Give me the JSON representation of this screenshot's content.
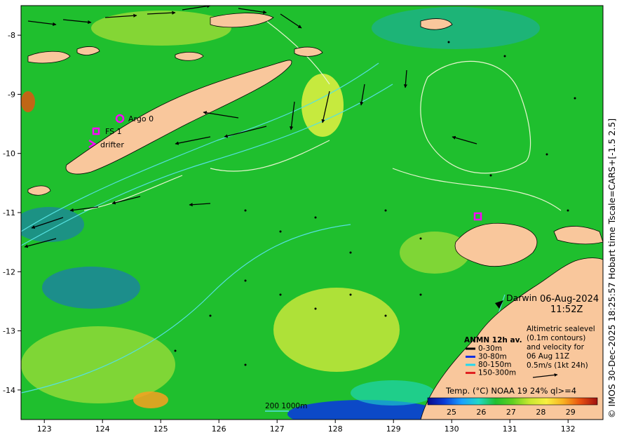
{
  "map": {
    "date": "06-Aug-2024",
    "time": "11:52Z",
    "place_label": "Darwin",
    "x_ticks": [
      "123",
      "124",
      "125",
      "126",
      "127",
      "128",
      "129",
      "130",
      "131",
      "132"
    ],
    "y_ticks": [
      "-8",
      "-9",
      "-10",
      "-11",
      "-12",
      "-13",
      "-14"
    ],
    "colors": {
      "land": "#f9c79c",
      "sea_base": "#1fbf2e",
      "sea_warm": "#c8e63a",
      "sea_cool": "#1a66d9",
      "contour": "#55e0e0",
      "sealevel_contour": "#e8f5d0",
      "marker": "#ff00ff",
      "arrow": "#000000"
    }
  },
  "legend_markers": [
    {
      "label": "Argo 0",
      "icon": "circle-icon"
    },
    {
      "label": "FS 1",
      "icon": "square-icon"
    },
    {
      "label": "drifter",
      "icon": "chevron-right-icon"
    }
  ],
  "anmn": {
    "title": "ANMN 12h av.",
    "items": [
      {
        "label": "0-30m",
        "color": "#000000"
      },
      {
        "label": "30-80m",
        "color": "#1030e0"
      },
      {
        "label": "80-150m",
        "color": "#20d8f0"
      },
      {
        "label": "150-300m",
        "color": "#e02020"
      }
    ]
  },
  "altimetry": {
    "lines": [
      "Altimetric sealevel",
      "(0.1m contours)",
      "and velocity for",
      "06 Aug 11Z",
      "0.5m/s (1kt 24h)"
    ]
  },
  "scale": {
    "label": "200  1000m"
  },
  "colorbar": {
    "title": "Temp. (°C) NOAA 19 24% ql>=4",
    "ticks": [
      "25",
      "26",
      "27",
      "28",
      "29"
    ],
    "stops": [
      "#0a0a8c",
      "#0a3cd8",
      "#1aa0ff",
      "#20d8c8",
      "#20c030",
      "#60d020",
      "#c8e830",
      "#f8f040",
      "#f8b020",
      "#e85010",
      "#a01010"
    ]
  },
  "sidebar": {
    "credit": "© IMOS 30-Dec-2025 18:25:57 Hobart time Tscale=CARS+[-1.5 2.5]"
  }
}
